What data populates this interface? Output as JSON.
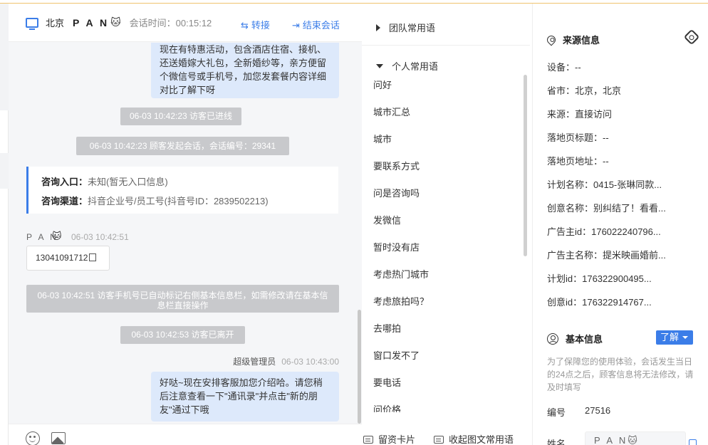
{
  "header": {
    "location": "北京",
    "visitor": "P A N",
    "cat_emoji": "🐱",
    "session_time": "会话时间：00:15:12",
    "transfer": "转接",
    "end_session": "结束会话"
  },
  "messages": {
    "top_bubble": "现在有特惠活动，包含酒店住宿、接机、还送婚嫁大礼包，全新婚纱等，亲方便留个微信号或手机号，加您发套餐内容详细对比了解下呀",
    "sys_entered": "06-03 10:42:23 访客已进线",
    "sys_started": "06-03 10:42:23 顾客发起会话，会话编号：29341",
    "entry_label": "咨询入口：",
    "entry_value": "未知(暂无入口信息)",
    "channel_label": "咨询渠道：",
    "channel_value": "抖音企业号/员工号(抖音号ID：2839502213)",
    "visitor_name": "P A N",
    "visitor_time": "06-03 10:42:51",
    "phone": "13041091712",
    "sys_phone_marked": "06-03 10:42:51 访客手机号已自动标记右侧基本信息栏，如需修改请在基本信息栏直接操作",
    "sys_left": "06-03 10:42:53 访客已离开",
    "admin_name": "超级管理员",
    "admin_time": "06-03 10:43:00",
    "admin_bubble": "好哒~现在安排客服加您介绍哈。请您稍后注意查看一下\"通讯录\"并点击\"新的朋友\"通过下哦"
  },
  "phrases": {
    "team_group": "团队常用语",
    "personal_group": "个人常用语",
    "items": [
      "问好",
      "城市汇总",
      "城市",
      "要联系方式",
      "问是咨询吗",
      "发微信",
      "暂时没有店",
      "考虑热门城市",
      "考虑旅拍吗？",
      "去哪拍",
      "窗口发不了",
      "要电话",
      "问价格"
    ],
    "footer_card": "留资卡片",
    "footer_collapse": "收起图文常用语"
  },
  "source": {
    "title": "来源信息",
    "device": "设备：--",
    "province": "省市：北京，北京",
    "origin": "来源：直接访问",
    "landing_title": "落地页标题：--",
    "landing_url": "落地页地址：--",
    "plan_name": "计划名称：0415-张琳同款...",
    "creative_name": "创意名称：别纠结了！看看...",
    "advertiser_id": "广告主id：176022240796...",
    "advertiser_name": "广告主名称：提米映画婚前...",
    "plan_id": "计划id：176322900495...",
    "creative_id": "创意id：176322914767..."
  },
  "basic": {
    "title": "基本信息",
    "learn": "了解",
    "tip": "为了保障您的使用体验，会话发生当日的24点之后，顾客信息将无法修改，请及时填写",
    "id_label": "编号",
    "id_value": "27516",
    "name_label": "姓名",
    "name_value": "P A N"
  }
}
